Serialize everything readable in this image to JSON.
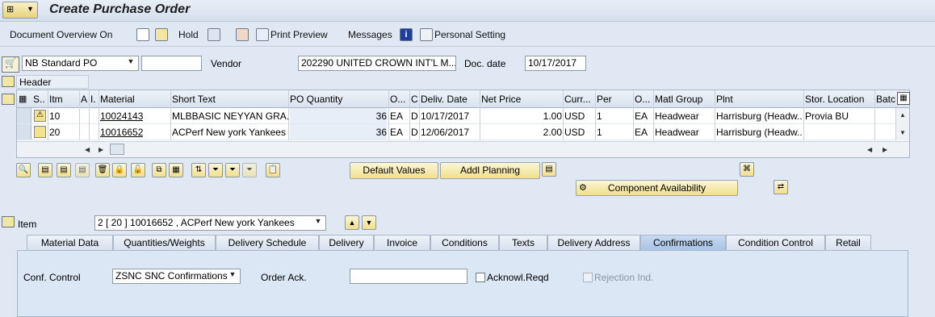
{
  "title": "Create Purchase Order",
  "toolbar": {
    "doc_overview": "Document Overview On",
    "hold": "Hold",
    "print_preview": "Print Preview",
    "messages": "Messages",
    "personal_setting": "Personal Setting"
  },
  "header": {
    "po_type": "NB Standard PO",
    "po_number": "",
    "vendor_label": "Vendor",
    "vendor_value": "202290 UNITED CROWN INT'L M...",
    "doc_date_label": "Doc. date",
    "doc_date_value": "10/17/2017",
    "header_label": "Header"
  },
  "grid": {
    "columns": [
      "S..",
      "Itm",
      "A",
      "I.",
      "Material",
      "Short Text",
      "PO Quantity",
      "O...",
      "C",
      "Deliv. Date",
      "Net Price",
      "Curr...",
      "Per",
      "O...",
      "Matl Group",
      "Plnt",
      "Stor. Location",
      "Batc"
    ],
    "rows": [
      {
        "itm": "10",
        "material": "10024143",
        "short_text": "MLBBASIC NEYYAN GRA...",
        "qty": "36",
        "oun": "EA",
        "c": "D",
        "deliv": "10/17/2017",
        "price": "1.00",
        "curr": "USD",
        "per": "1",
        "opu": "EA",
        "matl_group": "Headwear",
        "plant": "Harrisburg (Headw...",
        "stor": "Provia BU",
        "status": "warning"
      },
      {
        "itm": "20",
        "material": "10016652",
        "short_text": "ACPerf New york Yankees",
        "qty": "36",
        "oun": "EA",
        "c": "D",
        "deliv": "12/06/2017",
        "price": "2.00",
        "curr": "USD",
        "per": "1",
        "opu": "EA",
        "matl_group": "Headwear",
        "plant": "Harrisburg (Headw...",
        "stor": "",
        "status": "none"
      }
    ]
  },
  "buttons": {
    "default_values": "Default Values",
    "addl_planning": "Addl Planning",
    "component_availability": "Component Availability"
  },
  "item": {
    "label": "Item",
    "value": "2 [ 20 ] 10016652 , ACPerf New york Yankees"
  },
  "tabs": [
    "Material Data",
    "Quantities/Weights",
    "Delivery Schedule",
    "Delivery",
    "Invoice",
    "Conditions",
    "Texts",
    "Delivery Address",
    "Confirmations",
    "Condition Control",
    "Retail"
  ],
  "active_tab": "Confirmations",
  "confirmations": {
    "conf_control_label": "Conf. Control",
    "conf_control_value": "ZSNC SNC Confirmations",
    "order_ack_label": "Order Ack.",
    "order_ack_value": "",
    "acknowl_label": "Acknowl.Reqd",
    "rejection_label": "Rejection Ind."
  }
}
